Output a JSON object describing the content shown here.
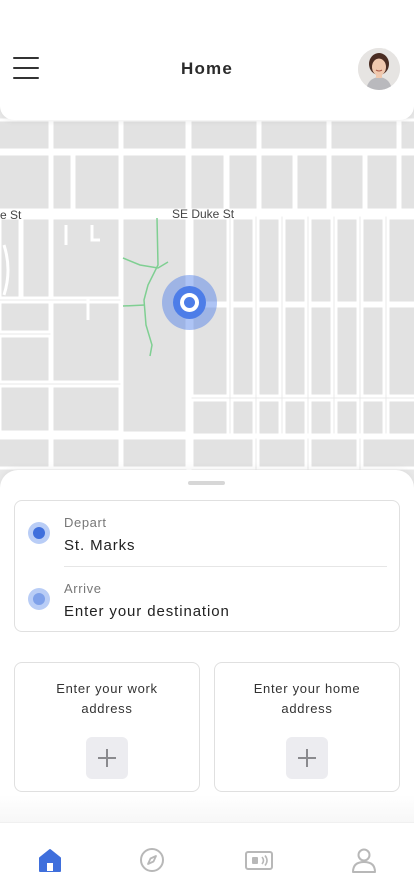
{
  "header": {
    "title": "Home",
    "menu_icon": "hamburger-menu-icon",
    "avatar_icon": "user-avatar"
  },
  "map": {
    "streets": [
      "e St",
      "SE Duke St"
    ],
    "location_icon": "current-location-icon"
  },
  "trip": {
    "depart": {
      "label": "Depart",
      "value": "St. Marks"
    },
    "arrive": {
      "label": "Arrive",
      "value": "Enter your destination"
    }
  },
  "saved_places": {
    "work": {
      "text": "Enter your work address",
      "icon": "plus-icon"
    },
    "home": {
      "text": "Enter your home address",
      "icon": "plus-icon"
    }
  },
  "tabbar": {
    "items": [
      {
        "name": "home",
        "icon": "home-icon",
        "active": true
      },
      {
        "name": "explore",
        "icon": "compass-icon",
        "active": false
      },
      {
        "name": "tickets",
        "icon": "ticket-icon",
        "active": false
      },
      {
        "name": "profile",
        "icon": "person-icon",
        "active": false
      }
    ]
  },
  "colors": {
    "accent": "#4d7de8",
    "accent_light": "#b9cdf6",
    "map_background": "#e9e9e9",
    "road": "#ffffff",
    "path": "#7fcf92",
    "tab_inactive": "#b8b8b8"
  }
}
